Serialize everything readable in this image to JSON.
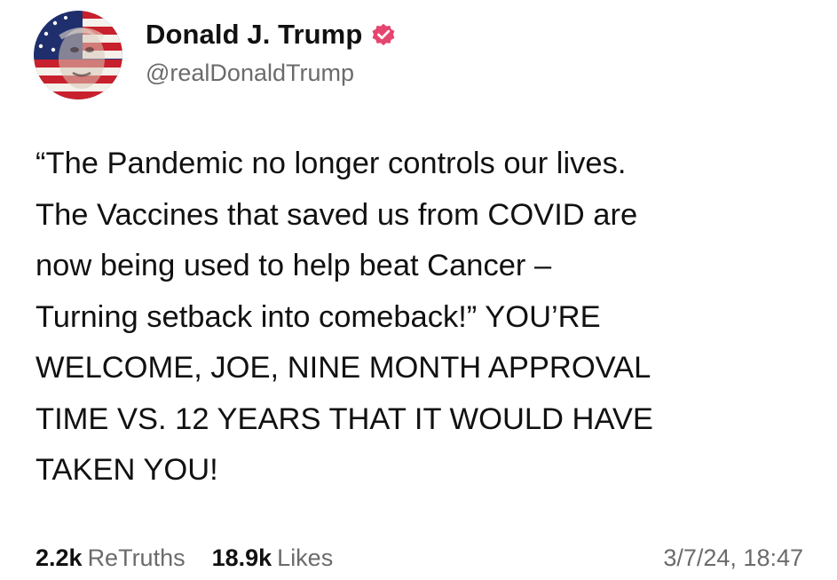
{
  "post": {
    "author": {
      "display_name": "Donald J. Trump",
      "handle": "@realDonaldTrump",
      "verified": true,
      "verified_icon": "verified-badge-icon",
      "avatar_icon": "avatar-flag-portrait"
    },
    "text": "“The Pandemic no longer controls our lives.\nThe Vaccines that saved us from COVID are\nnow being used to help beat Cancer –\nTurning setback into comeback!” YOU’RE\nWELCOME, JOE, NINE MONTH APPROVAL\nTIME VS. 12 YEARS THAT IT WOULD HAVE\nTAKEN YOU!",
    "stats": {
      "retruths_count": "2.2k",
      "retruths_label": "ReTruths",
      "likes_count": "18.9k",
      "likes_label": "Likes"
    },
    "timestamp": "3/7/24, 18:47"
  },
  "colors": {
    "text_primary": "#111111",
    "text_secondary": "#6b6b6b",
    "verified_badge": "#e5456e",
    "background": "#ffffff"
  }
}
